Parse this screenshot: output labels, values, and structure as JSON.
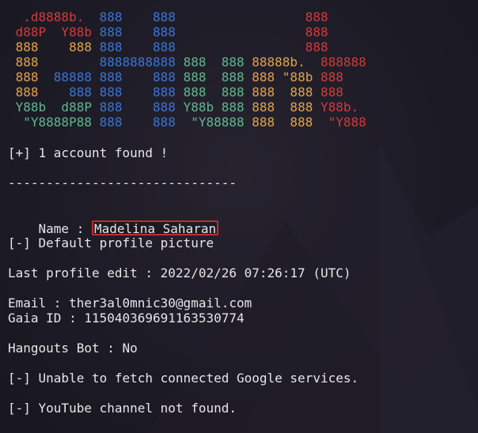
{
  "banner": {
    "rows": [
      [
        {
          "t": "  .d8888b.  ",
          "c": "red"
        },
        {
          "t": "888    ",
          "c": "blue"
        },
        {
          "t": "888                 ",
          "c": "blue"
        },
        {
          "t": "888",
          "c": "red"
        }
      ],
      [
        {
          "t": " d88P  Y88b ",
          "c": "red"
        },
        {
          "t": "888    ",
          "c": "blue"
        },
        {
          "t": "888                 ",
          "c": "blue"
        },
        {
          "t": "888",
          "c": "red"
        }
      ],
      [
        {
          "t": " 888    888 ",
          "c": "orange"
        },
        {
          "t": "888    ",
          "c": "blue"
        },
        {
          "t": "888                 ",
          "c": "blue"
        },
        {
          "t": "888",
          "c": "red"
        }
      ],
      [
        {
          "t": " 888        ",
          "c": "orange"
        },
        {
          "t": "8888888888 ",
          "c": "blue"
        },
        {
          "t": "888  888 ",
          "c": "green"
        },
        {
          "t": "88888b.  ",
          "c": "orange"
        },
        {
          "t": "888888",
          "c": "red"
        }
      ],
      [
        {
          "t": " 888  ",
          "c": "orange"
        },
        {
          "t": "88888 ",
          "c": "blue"
        },
        {
          "t": "888    888 ",
          "c": "blue"
        },
        {
          "t": "888  888 ",
          "c": "green"
        },
        {
          "t": "888 \"88b ",
          "c": "orange"
        },
        {
          "t": "888",
          "c": "red"
        }
      ],
      [
        {
          "t": " 888    ",
          "c": "orange"
        },
        {
          "t": "888 888    888 ",
          "c": "blue"
        },
        {
          "t": "888  888 ",
          "c": "green"
        },
        {
          "t": "888  888 ",
          "c": "orange"
        },
        {
          "t": "888",
          "c": "red"
        }
      ],
      [
        {
          "t": " Y88b  d88P ",
          "c": "green"
        },
        {
          "t": "888    888 ",
          "c": "blue"
        },
        {
          "t": "Y88b 888 ",
          "c": "green"
        },
        {
          "t": "888  888 ",
          "c": "orange"
        },
        {
          "t": "Y88b.",
          "c": "red"
        }
      ],
      [
        {
          "t": "  \"Y8888P88 ",
          "c": "green"
        },
        {
          "t": "888    888  ",
          "c": "blue"
        },
        {
          "t": "\"Y88888 ",
          "c": "green"
        },
        {
          "t": "888  888  ",
          "c": "orange"
        },
        {
          "t": "\"Y888",
          "c": "red"
        }
      ]
    ]
  },
  "output": {
    "found": "[+] 1 account found !",
    "divider": "------------------------------",
    "name_label": "Name : ",
    "name_value": "Madelina Saharan",
    "profile_picture": "[-] Default profile picture",
    "last_edit": "Last profile edit : 2022/02/26 07:26:17 (UTC)",
    "email": "Email : ther3al0mnic30@gmail.com",
    "gaia": "Gaia ID : 115040369691163530774",
    "hangouts": "Hangouts Bot : No",
    "google_services": "[-] Unable to fetch connected Google services.",
    "youtube": "[-] YouTube channel not found."
  },
  "colors": {
    "red": "#d23b3b",
    "orange": "#e3a24a",
    "blue": "#3b74d4",
    "green": "#5fb88f",
    "highlight_border": "#c42b2b",
    "background": "#1b1a24",
    "text": "#e6e6e6"
  }
}
